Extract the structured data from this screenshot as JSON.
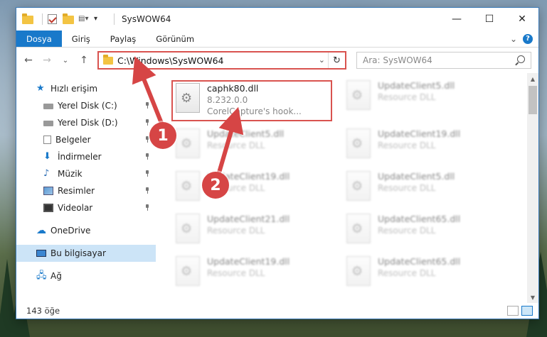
{
  "window": {
    "title": "SysWOW64",
    "controls": {
      "minimize": "—",
      "maximize": "☐",
      "close": "✕"
    }
  },
  "ribbon": {
    "tabs": [
      {
        "label": "Dosya",
        "active": true
      },
      {
        "label": "Giriş",
        "active": false
      },
      {
        "label": "Paylaş",
        "active": false
      },
      {
        "label": "Görünüm",
        "active": false
      }
    ],
    "expand": "⌄",
    "help": "?"
  },
  "nav": {
    "back": "←",
    "forward": "→",
    "recent": "⌄",
    "up": "↑",
    "address": "C:\\Windows\\SysWOW64",
    "address_drop": "⌄",
    "refresh": "↻",
    "search_placeholder": "Ara: SysWOW64"
  },
  "sidebar": {
    "items": [
      {
        "label": "Hızlı erişim",
        "icon": "star-icon"
      },
      {
        "label": "Yerel Disk (C:)",
        "icon": "disk-icon"
      },
      {
        "label": "Yerel Disk (D:)",
        "icon": "disk-icon"
      },
      {
        "label": "Belgeler",
        "icon": "document-icon"
      },
      {
        "label": "İndirmeler",
        "icon": "download-icon"
      },
      {
        "label": "Müzik",
        "icon": "music-icon"
      },
      {
        "label": "Resimler",
        "icon": "pictures-icon"
      },
      {
        "label": "Videolar",
        "icon": "video-icon"
      },
      {
        "label": "OneDrive",
        "icon": "cloud-icon"
      },
      {
        "label": "Bu bilgisayar",
        "icon": "computer-icon"
      },
      {
        "label": "Ağ",
        "icon": "network-icon"
      }
    ]
  },
  "files": [
    {
      "name": "caphk80.dll",
      "version": "8.232.0.0",
      "desc": "CorelCapture's hook..."
    },
    {
      "name": "UpdateClient5.dll",
      "desc": "Resource DLL"
    },
    {
      "name": "UpdateClient5.dll",
      "desc": "Resource DLL"
    },
    {
      "name": "UpdateClient19.dll",
      "desc": "Resource DLL"
    },
    {
      "name": "UpdateClient19.dll",
      "desc": "Resource DLL"
    },
    {
      "name": "UpdateClient5.dll",
      "desc": "Resource DLL"
    },
    {
      "name": "UpdateClient21.dll",
      "desc": "Resource DLL"
    },
    {
      "name": "UpdateClient65.dll",
      "desc": "Resource DLL"
    },
    {
      "name": "UpdateClient19.dll",
      "desc": "Resource DLL"
    },
    {
      "name": "UpdateClient65.dll",
      "desc": "Resource DLL"
    }
  ],
  "status": {
    "count": "143 öğe"
  },
  "callouts": {
    "one": "1",
    "two": "2"
  },
  "colors": {
    "accent": "#1979ca",
    "highlight": "#d9534f"
  }
}
